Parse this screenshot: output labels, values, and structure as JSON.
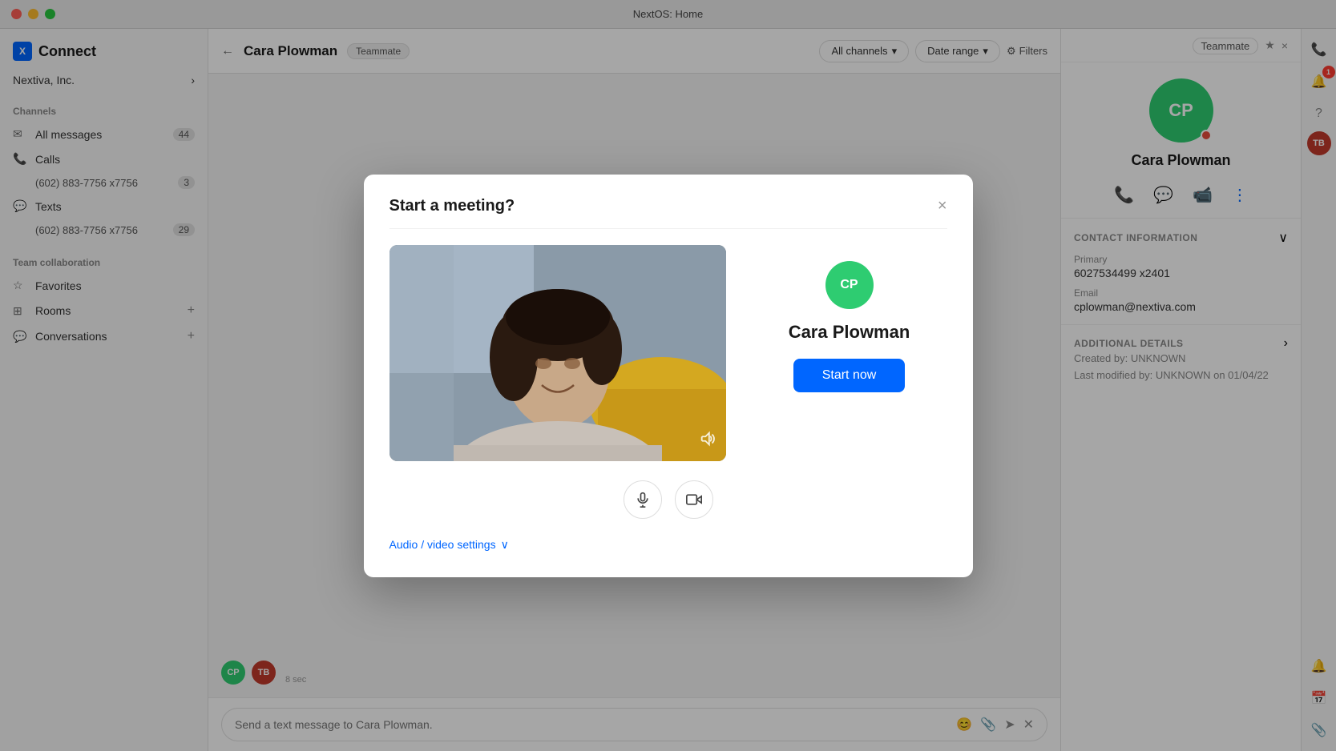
{
  "titleBar": {
    "title": "NextOS: Home"
  },
  "app": {
    "name": "Connect",
    "logo": "X"
  },
  "sidebar": {
    "company": "Nextiva, Inc.",
    "collapseBtn": "‹",
    "sections": [
      {
        "label": "Channels",
        "items": [
          {
            "icon": "envelope",
            "label": "All messages",
            "badge": "44"
          },
          {
            "icon": "phone",
            "label": "Calls",
            "badge": ""
          },
          {
            "icon": "phone-sub",
            "label": "(602) 883-7756 x7756",
            "badge": "3"
          },
          {
            "icon": "comment",
            "label": "Texts",
            "badge": ""
          },
          {
            "icon": "comment-sub",
            "label": "(602) 883-7756 x7756",
            "badge": "29"
          }
        ]
      },
      {
        "label": "Team collaboration",
        "items": [
          {
            "icon": "star",
            "label": "Favorites"
          },
          {
            "icon": "grid",
            "label": "Rooms",
            "add": true
          },
          {
            "icon": "chat",
            "label": "Conversations",
            "add": true
          }
        ]
      }
    ]
  },
  "chatHeader": {
    "backBtn": "←",
    "contactName": "Cara Plowman",
    "contactTag": "Teammate",
    "filters": {
      "allChannels": "All channels",
      "dateRange": "Date range",
      "filtersLabel": "Filters"
    },
    "rightTag": "Teammate",
    "starBtn": "★",
    "closeBtn": "×",
    "addBtn": "+"
  },
  "rightPanel": {
    "contactInitials": "CP",
    "contactName": "Cara Plowman",
    "actions": [
      "phone",
      "chat",
      "video",
      "more"
    ],
    "contactInfo": {
      "sectionTitle": "CONTACT INFORMATION",
      "primaryLabel": "Primary",
      "primaryValue": "6027534499 x2401",
      "emailLabel": "Email",
      "emailValue": "cplowman@nextiva.com"
    },
    "additionalDetails": {
      "sectionTitle": "ADDITIONAL DETAILS",
      "createdBy": "Created by: UNKNOWN",
      "lastModified": "Last modified by: UNKNOWN on 01/04/22"
    }
  },
  "messageInput": {
    "placeholder": "Send a text message to Cara Plowman."
  },
  "modal": {
    "title": "Start a meeting?",
    "closeBtn": "×",
    "calleeInitials": "CP",
    "calleeName": "Cara Plowman",
    "startNowBtn": "Start now",
    "micBtn": "🎤",
    "videoBtn": "🎥",
    "audioSettingsLabel": "Audio / video settings",
    "audioSettingsArrow": "∨"
  },
  "chatMessage": {
    "avatarCP": "CP",
    "avatarTB": "TB",
    "timeAgo": "8 sec",
    "cpColor": "#2ecc71",
    "tbColor": "#e74c3c"
  },
  "topBarIcons": {
    "phone": "📞",
    "bell": "🔔",
    "notifCount": "1",
    "help": "?",
    "userInitials": "TB"
  }
}
